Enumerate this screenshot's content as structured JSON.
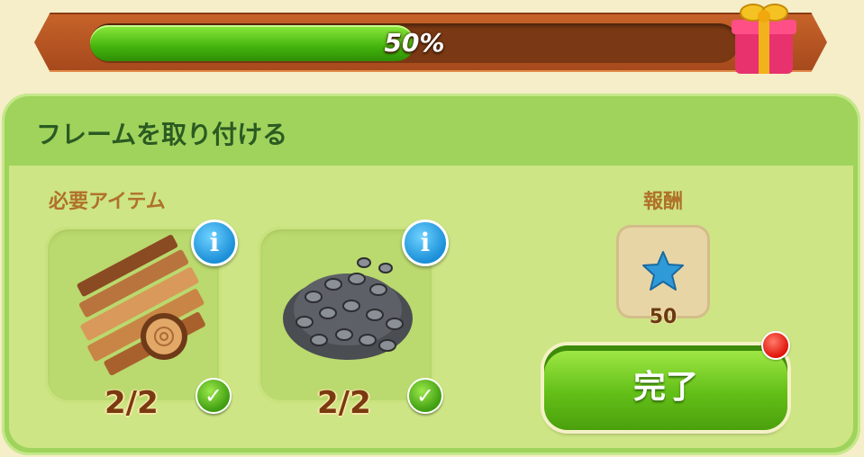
{
  "progress": {
    "percent_label": "50%",
    "value": 0.5
  },
  "task": {
    "title": "フレームを取り付ける"
  },
  "requirements": {
    "label": "必要アイテム",
    "items": [
      {
        "icon": "wood-planks-icon",
        "count": "2/2",
        "info": "i"
      },
      {
        "icon": "screws-icon",
        "count": "2/2",
        "info": "i"
      }
    ]
  },
  "reward": {
    "label": "報酬",
    "icon": "blue-star-icon",
    "amount": "50"
  },
  "complete_button": {
    "label": "完了"
  },
  "colors": {
    "progress_fill": "#43b40c",
    "panel": "#9fd35c",
    "accent_text": "#b0712a",
    "title_text": "#2b5a22"
  }
}
